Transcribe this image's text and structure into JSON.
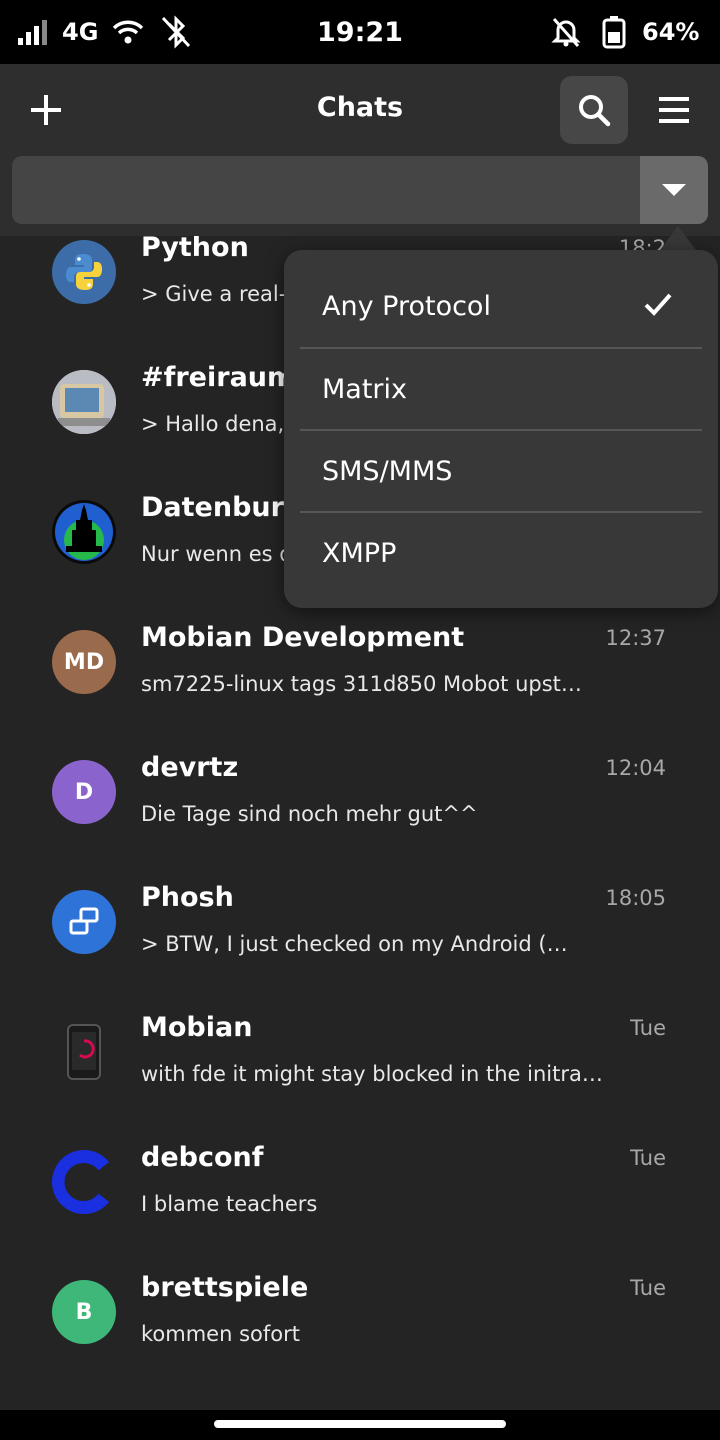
{
  "status_bar": {
    "network": "4G",
    "time": "19:21",
    "battery": "64%"
  },
  "header": {
    "title": "Chats"
  },
  "protocol_menu": {
    "items": [
      {
        "label": "Any Protocol",
        "selected": true
      },
      {
        "label": "Matrix",
        "selected": false
      },
      {
        "label": "SMS/MMS",
        "selected": false
      },
      {
        "label": "XMPP",
        "selected": false
      }
    ]
  },
  "chats": [
    {
      "name": "Python",
      "preview": "> Give a real-",
      "time": "18:2",
      "avatar": "python-logo"
    },
    {
      "name": "#freiraum",
      "preview": "> Hallo dena,",
      "time": "",
      "avatar": "freiraum-photo"
    },
    {
      "name": "Datenburg",
      "preview": "Nur wenn es d",
      "time": "",
      "avatar": "castle-logo"
    },
    {
      "name": "Mobian Development",
      "preview": "sm7225-linux tags 311d850 Mobot upst…",
      "time": "12:37",
      "avatar_initials": "MD",
      "color": "#9a6a4c"
    },
    {
      "name": "devrtz",
      "preview": "Die Tage sind noch mehr gut^^",
      "time": "12:04",
      "avatar_initials": "D",
      "color": "#8b63cc"
    },
    {
      "name": "Phosh",
      "preview": "> BTW, I just checked on my Android (…",
      "time": "18:05",
      "avatar": "phosh-logo"
    },
    {
      "name": "Mobian",
      "preview": "with fde it might stay blocked in the initra…",
      "time": "Tue",
      "avatar": "phone-icon"
    },
    {
      "name": "debconf",
      "preview": "I blame teachers",
      "time": "Tue",
      "avatar": "debconf-logo"
    },
    {
      "name": "brettspiele",
      "preview": "kommen sofort",
      "time": "Tue",
      "avatar_initials": "B",
      "color": "#3fb779"
    }
  ],
  "colors": {
    "background": "#242424",
    "header": "#2e2e2e",
    "popover": "#383838"
  }
}
